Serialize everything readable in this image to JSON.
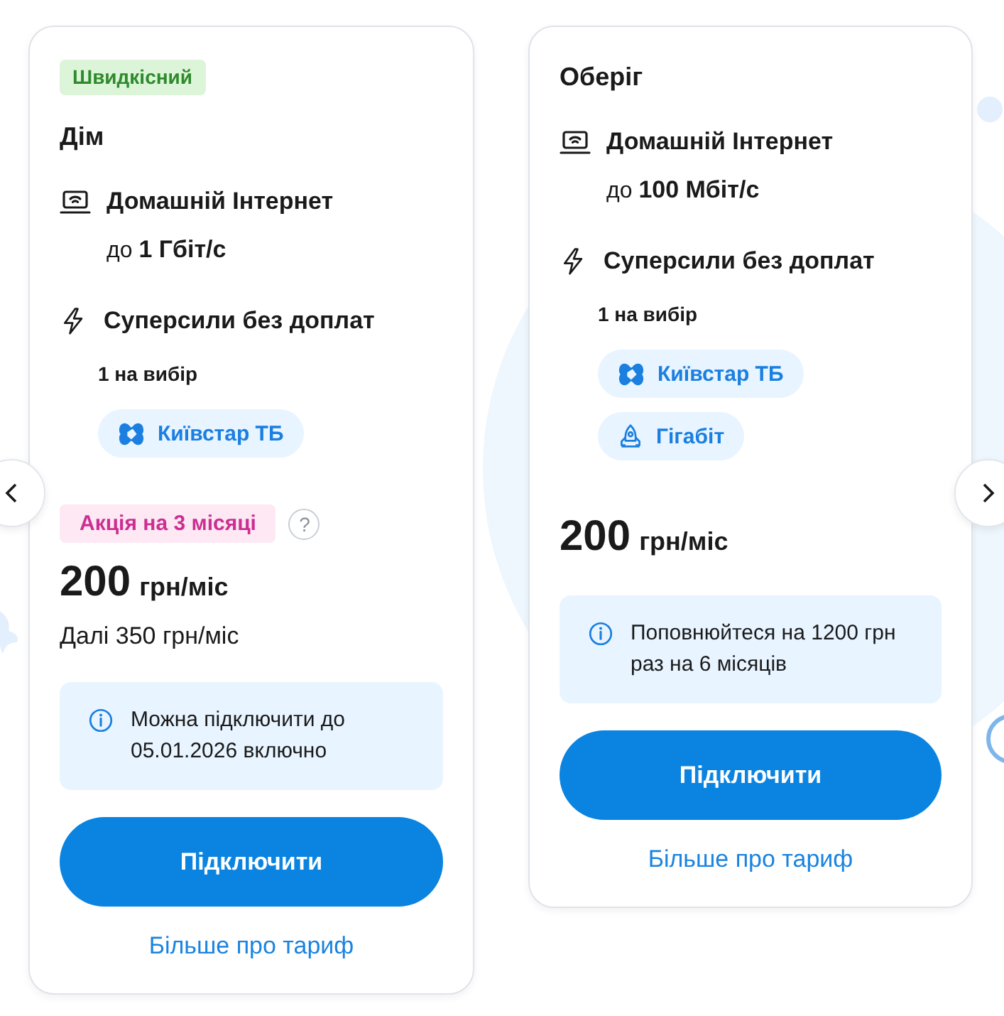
{
  "cards": [
    {
      "badge": "Швидкісний",
      "name": "Дім",
      "internet": {
        "title": "Домашній Інтернет",
        "speed": "до **1 Гбіт/с**"
      },
      "extras": {
        "title": "Суперсили без доплат",
        "choice": "1 на вибір",
        "options": [
          {
            "kind": "tv",
            "label": "Київстар ТБ"
          }
        ]
      },
      "promo": {
        "label": "Акція на 3 місяці",
        "help": "?"
      },
      "price": {
        "amount": "200",
        "unit": "грн/міс"
      },
      "after": "Далі 350 грн/міс",
      "info": "Можна підключити до 05.01.2026 включно",
      "button": "Підключити",
      "link": "Більше про тариф"
    },
    {
      "name": "Оберіг",
      "internet": {
        "title": "Домашній Інтернет",
        "speed": "до **100 Мбіт/с**"
      },
      "extras": {
        "title": "Суперсили без доплат",
        "choice": "1 на вибір",
        "options": [
          {
            "kind": "tv",
            "label": "Київстар ТБ"
          },
          {
            "kind": "rocket",
            "label": "Гігабіт"
          }
        ]
      },
      "price": {
        "amount": "200",
        "unit": "грн/міс"
      },
      "info": "Поповнюйтеся на 1200 грн раз на 6 місяців",
      "button": "Підключити",
      "link": "Більше про тариф"
    }
  ]
}
